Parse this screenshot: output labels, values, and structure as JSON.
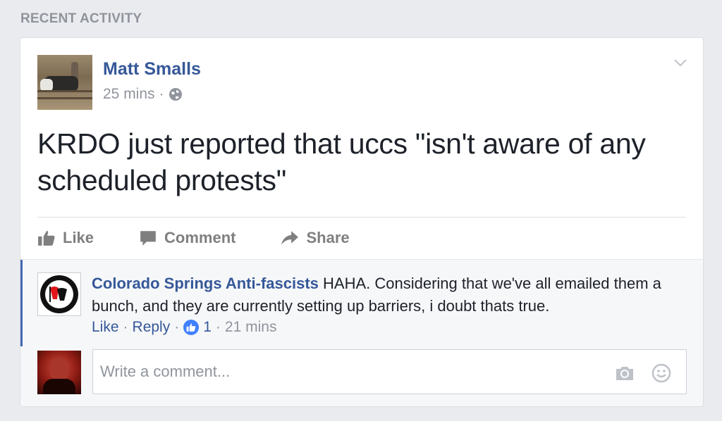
{
  "section": {
    "title": "RECENT ACTIVITY"
  },
  "post": {
    "author": "Matt Smalls",
    "time": "25 mins",
    "separator": "·",
    "text": "KRDO just reported that uccs \"isn't aware of any scheduled protests\"",
    "privacy_icon": "globe-icon",
    "actions": {
      "like": "Like",
      "comment": "Comment",
      "share": "Share"
    }
  },
  "comment": {
    "author": "Colorado Springs Anti-fascists",
    "text": "HAHA. Considering that we've all emailed them a bunch, and they are currently setting up barriers, i doubt thats true.",
    "like_label": "Like",
    "reply_label": "Reply",
    "separator": "·",
    "like_count": "1",
    "time": "21 mins"
  },
  "composer": {
    "placeholder": "Write a comment..."
  },
  "colors": {
    "link": "#365899",
    "muted": "#90949c",
    "accent": "#4267b2",
    "like_badge": "#4080ff"
  }
}
